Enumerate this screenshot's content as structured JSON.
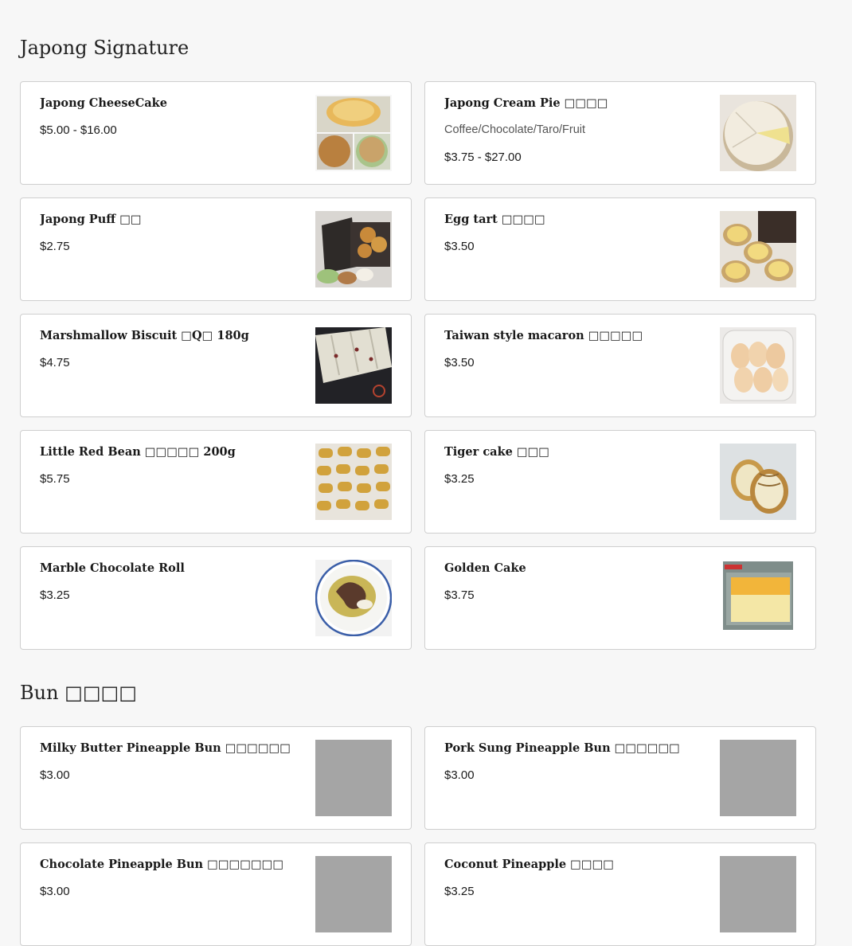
{
  "sections": [
    {
      "title": "Japong Signature",
      "items": [
        {
          "name": "Japong CheeseCake",
          "price": "$5.00 - $16.00"
        },
        {
          "name": "Japong Cream Pie □□□□",
          "description": "Coffee/Chocolate/Taro/Fruit",
          "price": "$3.75 - $27.00"
        },
        {
          "name": "Japong Puff □□",
          "price": "$2.75"
        },
        {
          "name": "Egg tart □□□□",
          "price": "$3.50"
        },
        {
          "name": "Marshmallow Biscuit □Q□ 180g",
          "price": "$4.75"
        },
        {
          "name": "Taiwan style macaron □□□□□",
          "price": "$3.50"
        },
        {
          "name": "Little Red Bean □□□□□ 200g",
          "price": "$5.75"
        },
        {
          "name": "Tiger cake □□□",
          "price": "$3.25"
        },
        {
          "name": "Marble Chocolate Roll",
          "price": "$3.25"
        },
        {
          "name": "Golden Cake",
          "price": "$3.75"
        }
      ]
    },
    {
      "title": "Bun □□□□",
      "items": [
        {
          "name": "Milky Butter Pineapple Bun □□□□□□",
          "price": "$3.00"
        },
        {
          "name": "Pork Sung Pineapple Bun □□□□□□",
          "price": "$3.00"
        },
        {
          "name": "Chocolate Pineapple Bun □□□□□□□",
          "price": "$3.00"
        },
        {
          "name": "Coconut Pineapple □□□□",
          "price": "$3.25"
        }
      ]
    }
  ]
}
